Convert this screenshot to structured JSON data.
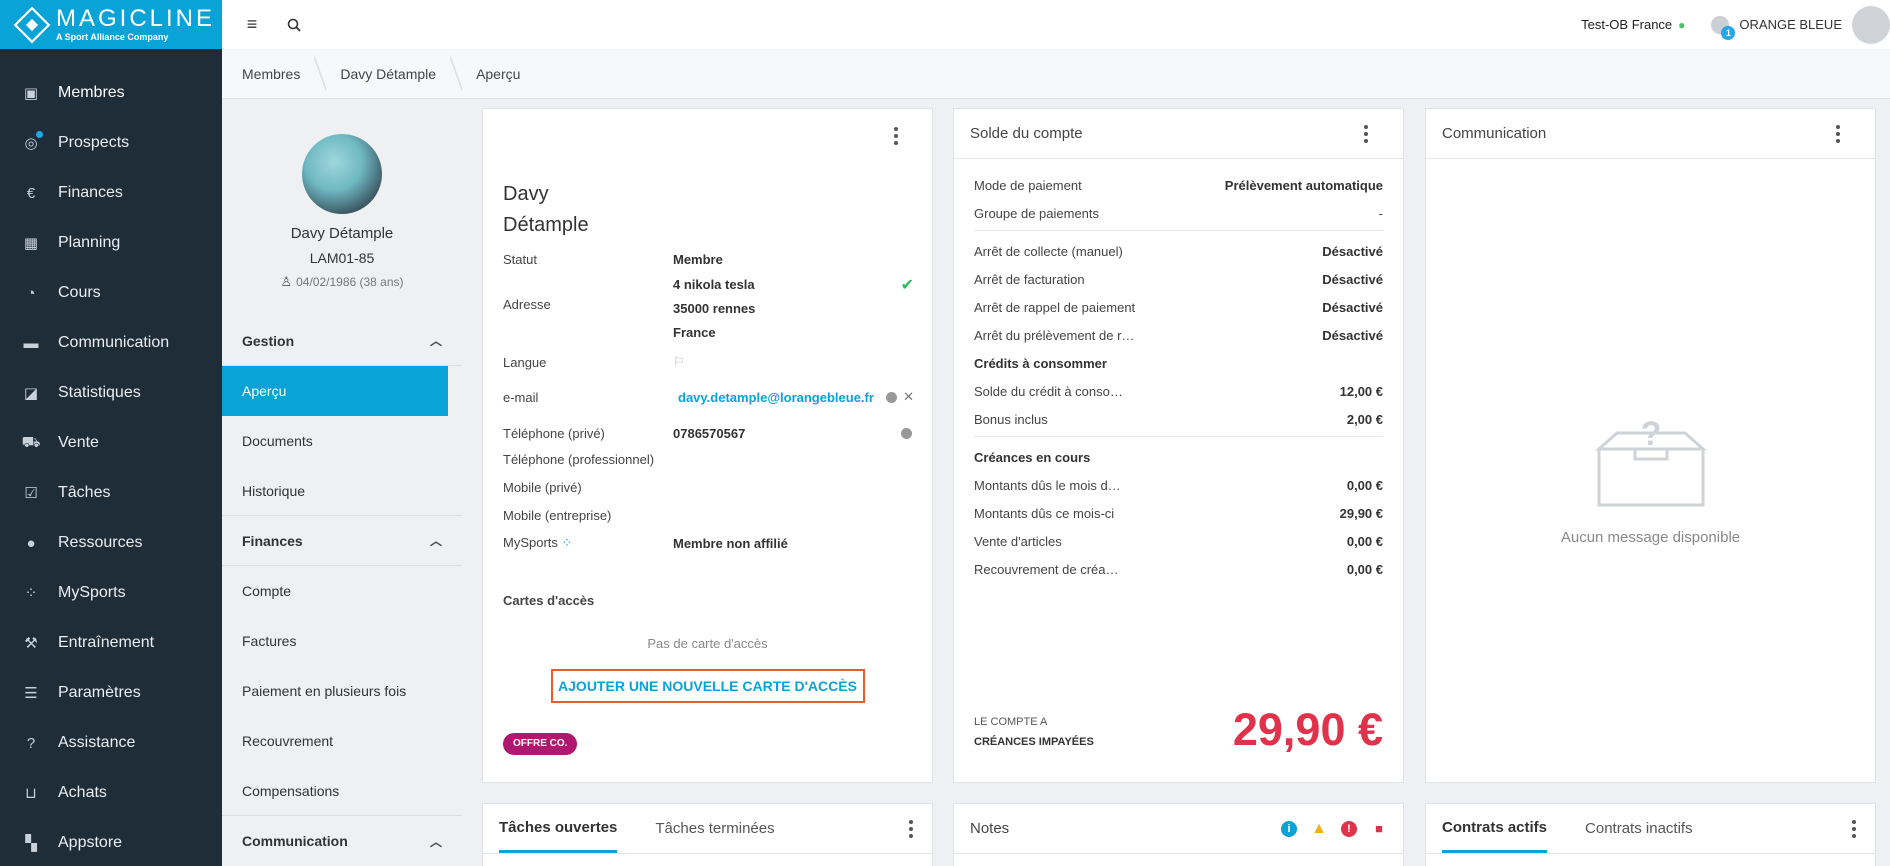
{
  "app": {
    "brand": "MAGICLINE",
    "brand_sub": "A Sport Alliance Company"
  },
  "colors": {
    "accent": "#0aa3d8",
    "sidebar": "#1e2d38",
    "balance_due": "#e1324b",
    "offer_badge": "#b0186f",
    "highlight_border": "#f0582d"
  },
  "sidebar": {
    "items": [
      {
        "label": "Membres",
        "icon": "member-card-icon"
      },
      {
        "label": "Prospects",
        "icon": "target-icon"
      },
      {
        "label": "Finances",
        "icon": "euro-icon"
      },
      {
        "label": "Planning",
        "icon": "calendar-icon"
      },
      {
        "label": "Cours",
        "icon": "stopwatch-icon"
      },
      {
        "label": "Communication",
        "icon": "chat-icon"
      },
      {
        "label": "Statistiques",
        "icon": "chart-icon"
      },
      {
        "label": "Vente",
        "icon": "cart-icon"
      },
      {
        "label": "Tâches",
        "icon": "checkbox-icon"
      },
      {
        "label": "Ressources",
        "icon": "people-icon"
      },
      {
        "label": "MySports",
        "icon": "mysports-icon"
      },
      {
        "label": "Entraînement",
        "icon": "dumbbell-icon"
      },
      {
        "label": "Paramètres",
        "icon": "sliders-icon"
      },
      {
        "label": "Assistance",
        "icon": "help-icon"
      },
      {
        "label": "Achats",
        "icon": "bag-icon"
      },
      {
        "label": "Appstore",
        "icon": "grid-icon"
      }
    ]
  },
  "topbar": {
    "location": "Test-OB France",
    "notifications": "1",
    "user": "ORANGE BLEUE"
  },
  "breadcrumb": [
    "Membres",
    "Davy Détample",
    "Aperçu"
  ],
  "member": {
    "name": "Davy Détample",
    "id": "LAM01-85",
    "dob": "04/02/1986 (38 ans)",
    "menu": {
      "gestion": "Gestion",
      "apercu": "Aperçu",
      "documents": "Documents",
      "historique": "Historique",
      "finances": "Finances",
      "compte": "Compte",
      "factures": "Factures",
      "paiement": "Paiement en plusieurs fois",
      "recouvrement": "Recouvrement",
      "compensations": "Compensations",
      "communication": "Communication"
    }
  },
  "profile": {
    "first_name": "Davy",
    "last_name": "Détample",
    "status_label": "Statut",
    "status": "Membre",
    "address_label": "Adresse",
    "address": [
      "4 nikola tesla",
      "35000 rennes",
      "France"
    ],
    "language_label": "Langue",
    "email_label": "e-mail",
    "email": "davy.detample@lorangebleue.fr",
    "phone_private_label": "Téléphone (privé)",
    "phone_private": "0786570567",
    "phone_pro_label": "Téléphone (professionnel)",
    "mobile_private_label": "Mobile (privé)",
    "mobile_company_label": "Mobile (entreprise)",
    "mysports_label": "MySports",
    "mysports": "Membre non affilié",
    "access_title": "Cartes d'accès",
    "no_card": "Pas de carte d'accès",
    "add_card": "AJOUTER UNE NOUVELLE CARTE D'ACCÈS",
    "offer": "OFFRE CO."
  },
  "balance": {
    "title": "Solde du compte",
    "rows_a": [
      {
        "label": "Mode de paiement",
        "value": "Prélèvement automatique"
      },
      {
        "label": "Groupe de paiements",
        "value": "-"
      }
    ],
    "rows_b": [
      {
        "label": "Arrêt de collecte (manuel)",
        "value": "Désactivé"
      },
      {
        "label": "Arrêt de facturation",
        "value": "Désactivé"
      },
      {
        "label": "Arrêt de rappel de paiement",
        "value": "Désactivé"
      },
      {
        "label": "Arrêt du prélèvement de r…",
        "value": "Désactivé"
      }
    ],
    "credits_title": "Crédits à consommer",
    "credits": [
      {
        "label": "Solde du crédit à conso…",
        "value": "12,00 €"
      },
      {
        "label": "Bonus inclus",
        "value": "2,00 €"
      }
    ],
    "debts_title": "Créances en cours",
    "debts": [
      {
        "label": "Montants dûs le mois d…",
        "value": "0,00 €"
      },
      {
        "label": "Montants dûs ce mois-ci",
        "value": "29,90 €"
      },
      {
        "label": "Vente d'articles",
        "value": "0,00 €"
      },
      {
        "label": "Recouvrement de créa…",
        "value": "0,00 €"
      }
    ],
    "footer_l1": "LE COMPTE A",
    "footer_l2": "CRÉANCES IMPAYÉES",
    "amount": "29,90 €"
  },
  "communication": {
    "title": "Communication",
    "empty": "Aucun message disponible"
  },
  "tasks": {
    "open": "Tâches ouvertes",
    "done": "Tâches terminées"
  },
  "notes": {
    "title": "Notes"
  },
  "contracts": {
    "active": "Contrats actifs",
    "inactive": "Contrats inactifs"
  }
}
